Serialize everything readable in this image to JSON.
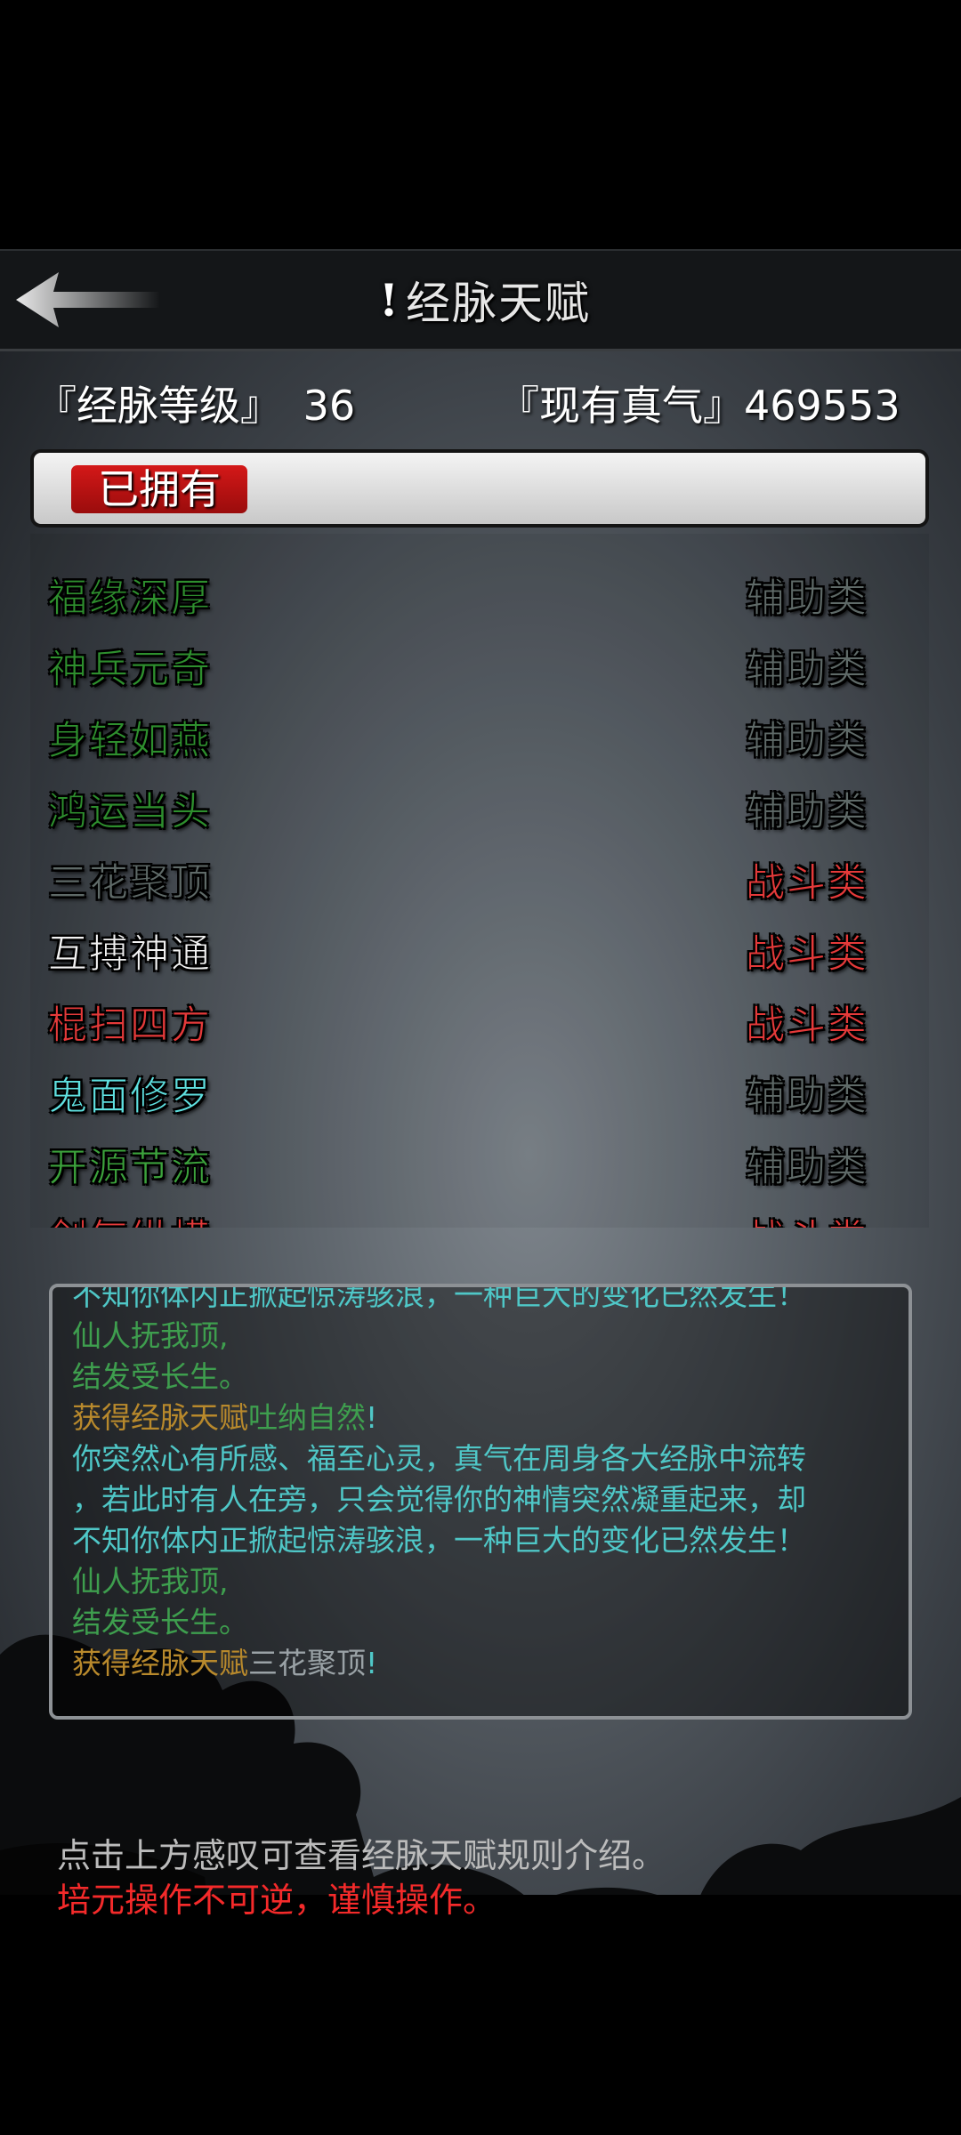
{
  "header": {
    "title": "经脉天赋",
    "info_mark": "!"
  },
  "stats": {
    "level_label": "『经脉等级』",
    "level_value": "36",
    "qi_label": "『现有真气』",
    "qi_value": "469553"
  },
  "tabs": {
    "owned": "已拥有"
  },
  "talents": [
    {
      "name": "福缘深厚",
      "category": "辅助类"
    },
    {
      "name": "神兵元奇",
      "category": "辅助类"
    },
    {
      "name": "身轻如燕",
      "category": "辅助类"
    },
    {
      "name": "鸿运当头",
      "category": "辅助类"
    },
    {
      "name": "三花聚顶",
      "category": "战斗类"
    },
    {
      "name": "互搏神通",
      "category": "战斗类"
    },
    {
      "name": "棍扫四方",
      "category": "战斗类"
    },
    {
      "name": "鬼面修罗",
      "category": "辅助类"
    },
    {
      "name": "开源节流",
      "category": "辅助类"
    },
    {
      "name": "剑气纵横",
      "category": "战斗类"
    }
  ],
  "log": {
    "line0": "不知你体内正掀起惊涛骇浪，一种巨大的变化已然发生！",
    "line1": "仙人抚我顶,",
    "line2": "结发受长生。",
    "line3a": "获得经脉天赋",
    "line3b": "吐纳自然",
    "line3c": "!",
    "line4": "你突然心有所感、福至心灵，真气在周身各大经脉中流转",
    "line5": "，若此时有人在旁，只会觉得你的神情突然凝重起来，却",
    "line6": "不知你体内正掀起惊涛骇浪，一种巨大的变化已然发生！",
    "line7": "仙人抚我顶,",
    "line8": "结发受长生。",
    "line9a": "获得经脉天赋",
    "line9b": "三花聚顶",
    "line9c": "!"
  },
  "footer": {
    "hint": "点击上方感叹可查看经脉天赋规则介绍。",
    "warning": "培元操作不可逆，谨慎操作。"
  },
  "colors": {
    "auxiliary_category": "#5f6a68",
    "combat_category": "#e53a3a",
    "tab_active": "#c41212",
    "warning": "#f42a2a"
  }
}
